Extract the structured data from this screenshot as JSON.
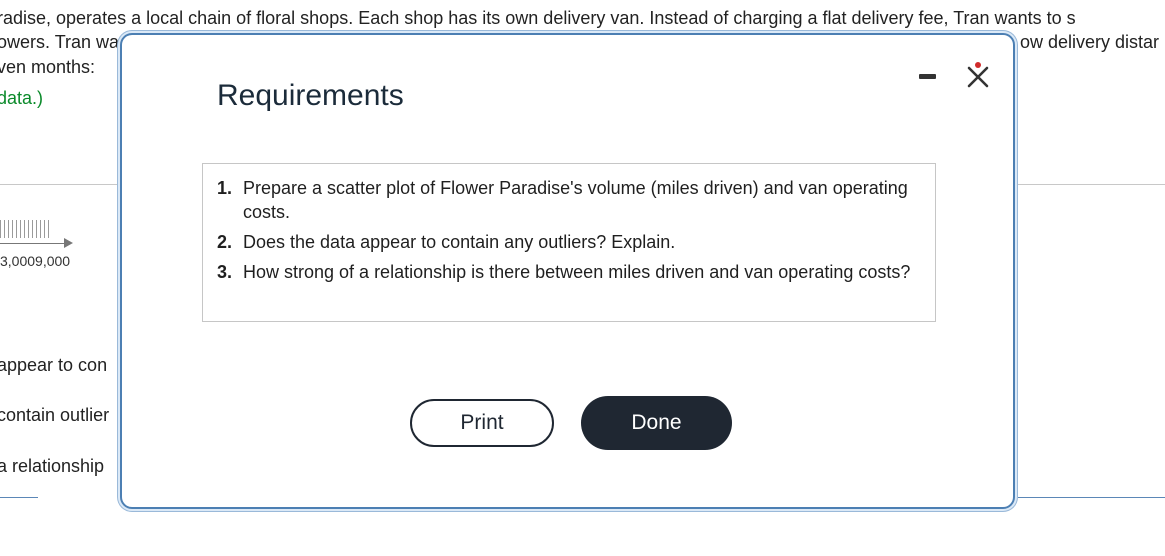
{
  "background": {
    "lines": [
      "radise, operates a local chain of floral shops. Each shop has its own delivery van. Instead of charging a flat delivery fee, Tran wants to s",
      "owers. Tran wa",
      "ow delivery distar",
      "ven months:",
      "data.)",
      "appear to con",
      "contain outlier",
      "a relationship"
    ],
    "axis_tick_label": "3,0009,000"
  },
  "modal": {
    "title": "Requirements",
    "minimize_label": "minimize",
    "close_label": "close",
    "requirements": [
      {
        "num": "1.",
        "text": "Prepare a scatter plot of Flower Paradise's volume (miles driven) and van operating costs."
      },
      {
        "num": "2.",
        "text": "Does the data appear to contain any outliers? Explain."
      },
      {
        "num": "3.",
        "text": "How strong of a relationship is there between miles driven and van operating costs?"
      }
    ],
    "print_label": "Print",
    "done_label": "Done"
  },
  "colors": {
    "modal_border": "#4c7fb3",
    "done_button": "#1f2732",
    "link_green": "#0a8a2a",
    "close_accent": "#d12b2b"
  }
}
